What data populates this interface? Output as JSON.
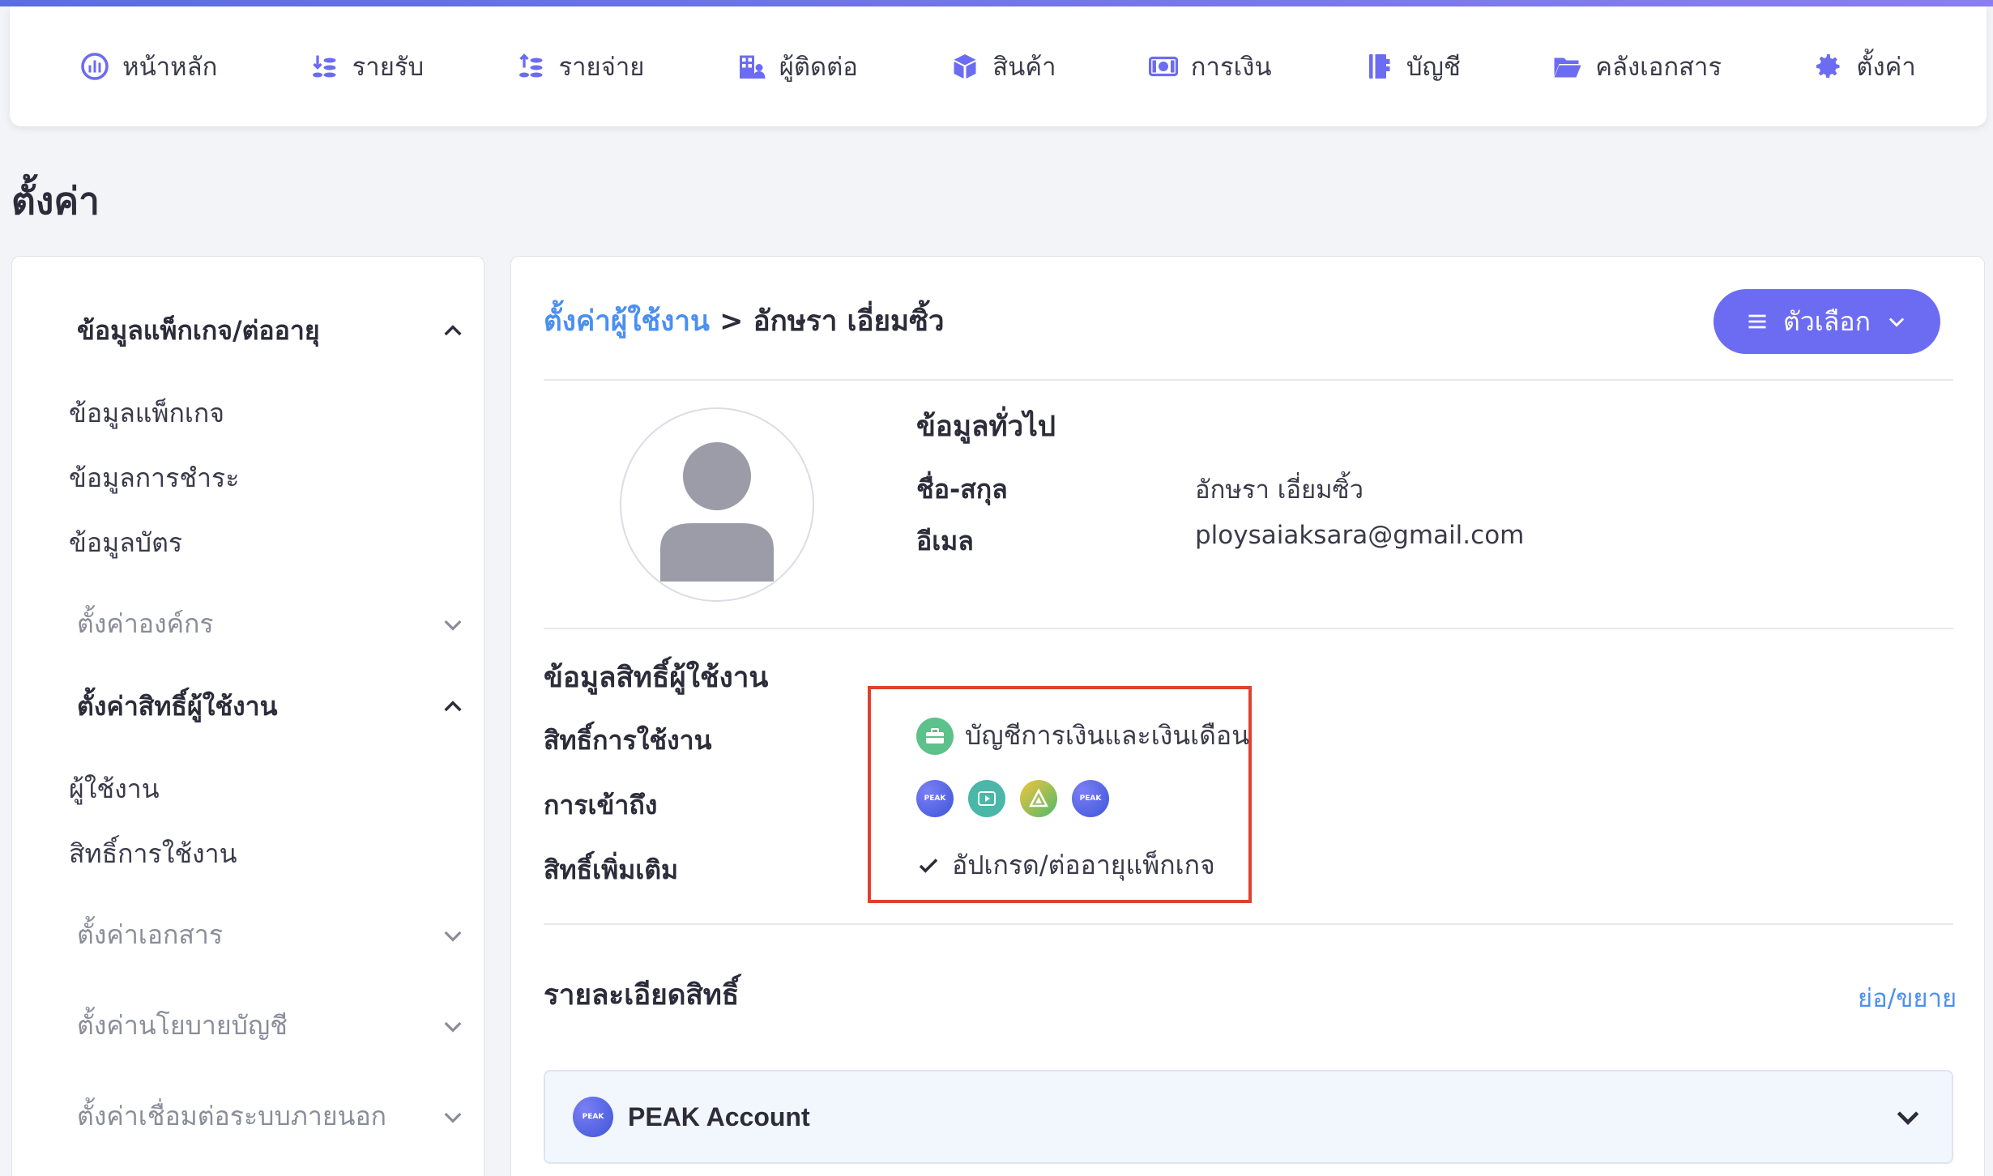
{
  "nav": {
    "items": [
      {
        "label": "หน้าหลัก",
        "icon": "dashboard-icon"
      },
      {
        "label": "รายรับ",
        "icon": "income-icon"
      },
      {
        "label": "รายจ่าย",
        "icon": "expense-icon"
      },
      {
        "label": "ผู้ติดต่อ",
        "icon": "contacts-icon"
      },
      {
        "label": "สินค้า",
        "icon": "box-icon"
      },
      {
        "label": "การเงิน",
        "icon": "money-icon"
      },
      {
        "label": "บัญชี",
        "icon": "ledger-icon"
      },
      {
        "label": "คลังเอกสาร",
        "icon": "folder-icon"
      },
      {
        "label": "ตั้งค่า",
        "icon": "gear-icon"
      }
    ]
  },
  "page": {
    "title": "ตั้งค่า"
  },
  "sidebar": {
    "package_group": "ข้อมูลแพ็กเกจ/ต่ออายุ",
    "package_links": [
      "ข้อมูลแพ็กเกจ",
      "ข้อมูลการชำระ",
      "ข้อมูลบัตร"
    ],
    "org_group": "ตั้งค่าองค์กร",
    "perm_group": "ตั้งค่าสิทธิ์ผู้ใช้งาน",
    "perm_links": [
      "ผู้ใช้งาน",
      "สิทธิ์การใช้งาน"
    ],
    "doc_group": "ตั้งค่าเอกสาร",
    "policy_group": "ตั้งค่านโยบายบัญชี",
    "external_group": "ตั้งค่าเชื่อมต่อระบบภายนอก"
  },
  "main": {
    "breadcrumb_link": "ตั้งค่าผู้ใช้งาน",
    "breadcrumb_sep": ">",
    "breadcrumb_current": "อักษรา เอี่ยมซิ้ว",
    "options_label": "ตัวเลือก",
    "general": {
      "heading": "ข้อมูลทั่วไป",
      "name_label": "ชื่อ-สกุล",
      "name_value": "อักษรา เอี่ยมซิ้ว",
      "email_label": "อีเมล",
      "email_value": "ploysaiaksara@gmail.com"
    },
    "perms": {
      "heading": "ข้อมูลสิทธิ์ผู้ใช้งาน",
      "role_label": "สิทธิ์การใช้งาน",
      "role_value": "บัญชีการเงินและเงินเดือน",
      "access_label": "การเข้าถึง",
      "extra_label": "สิทธิ์เพิ่มเติม",
      "extra_value": "อัปเกรด/ต่ออายุแพ็กเกจ",
      "app_icon_text_peak": "PEAK",
      "app_icon_text_peak2": "PEAK"
    },
    "details": {
      "heading": "รายละเอียดสิทธิ์",
      "toggle_label": "ย่อ/ขยาย",
      "accordion_title": "PEAK Account",
      "accordion_icon_text": "PEAK"
    }
  },
  "colors": {
    "accent": "#6c6cf2",
    "link": "#4b8ff0",
    "highlight_border": "#e04030"
  }
}
